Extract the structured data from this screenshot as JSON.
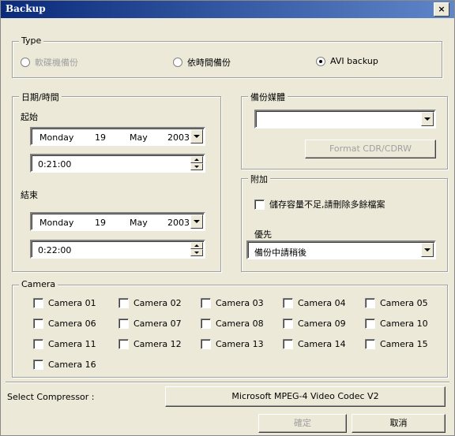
{
  "window": {
    "title": "Backup",
    "close": "×"
  },
  "type_group": {
    "legend": "Type",
    "options": [
      {
        "label": "軟碟機備份",
        "selected": false,
        "disabled": true
      },
      {
        "label": "依時間備份",
        "selected": false,
        "disabled": false
      },
      {
        "label": "AVI backup",
        "selected": true,
        "disabled": false
      }
    ]
  },
  "datetime_group": {
    "legend": "日期/時間",
    "start_label": "起始",
    "start_date": {
      "weekday": "Monday",
      "day": "19",
      "month": "May",
      "year": "2003"
    },
    "start_time": "0:21:00",
    "end_label": "結束",
    "end_date": {
      "weekday": "Monday",
      "day": "19",
      "month": "May",
      "year": "2003"
    },
    "end_time": "0:22:00"
  },
  "media_group": {
    "legend": "備份媒體",
    "selected": "",
    "format_button": "Format CDR/CDRW"
  },
  "extra_group": {
    "legend": "附加",
    "delete_old_label": "儲存容量不足,請刪除多餘檔案",
    "priority_label": "優先",
    "priority_value": "備份中請稍後"
  },
  "camera_group": {
    "legend": "Camera",
    "cameras": [
      "Camera 01",
      "Camera 02",
      "Camera 03",
      "Camera 04",
      "Camera 05",
      "Camera 06",
      "Camera 07",
      "Camera 08",
      "Camera 09",
      "Camera 10",
      "Camera 11",
      "Camera 12",
      "Camera 13",
      "Camera 14",
      "Camera 15",
      "Camera 16"
    ]
  },
  "compressor": {
    "label": "Select Compressor :",
    "value": "Microsoft MPEG-4 Video Codec V2"
  },
  "buttons": {
    "ok": "確定",
    "cancel": "取消"
  }
}
